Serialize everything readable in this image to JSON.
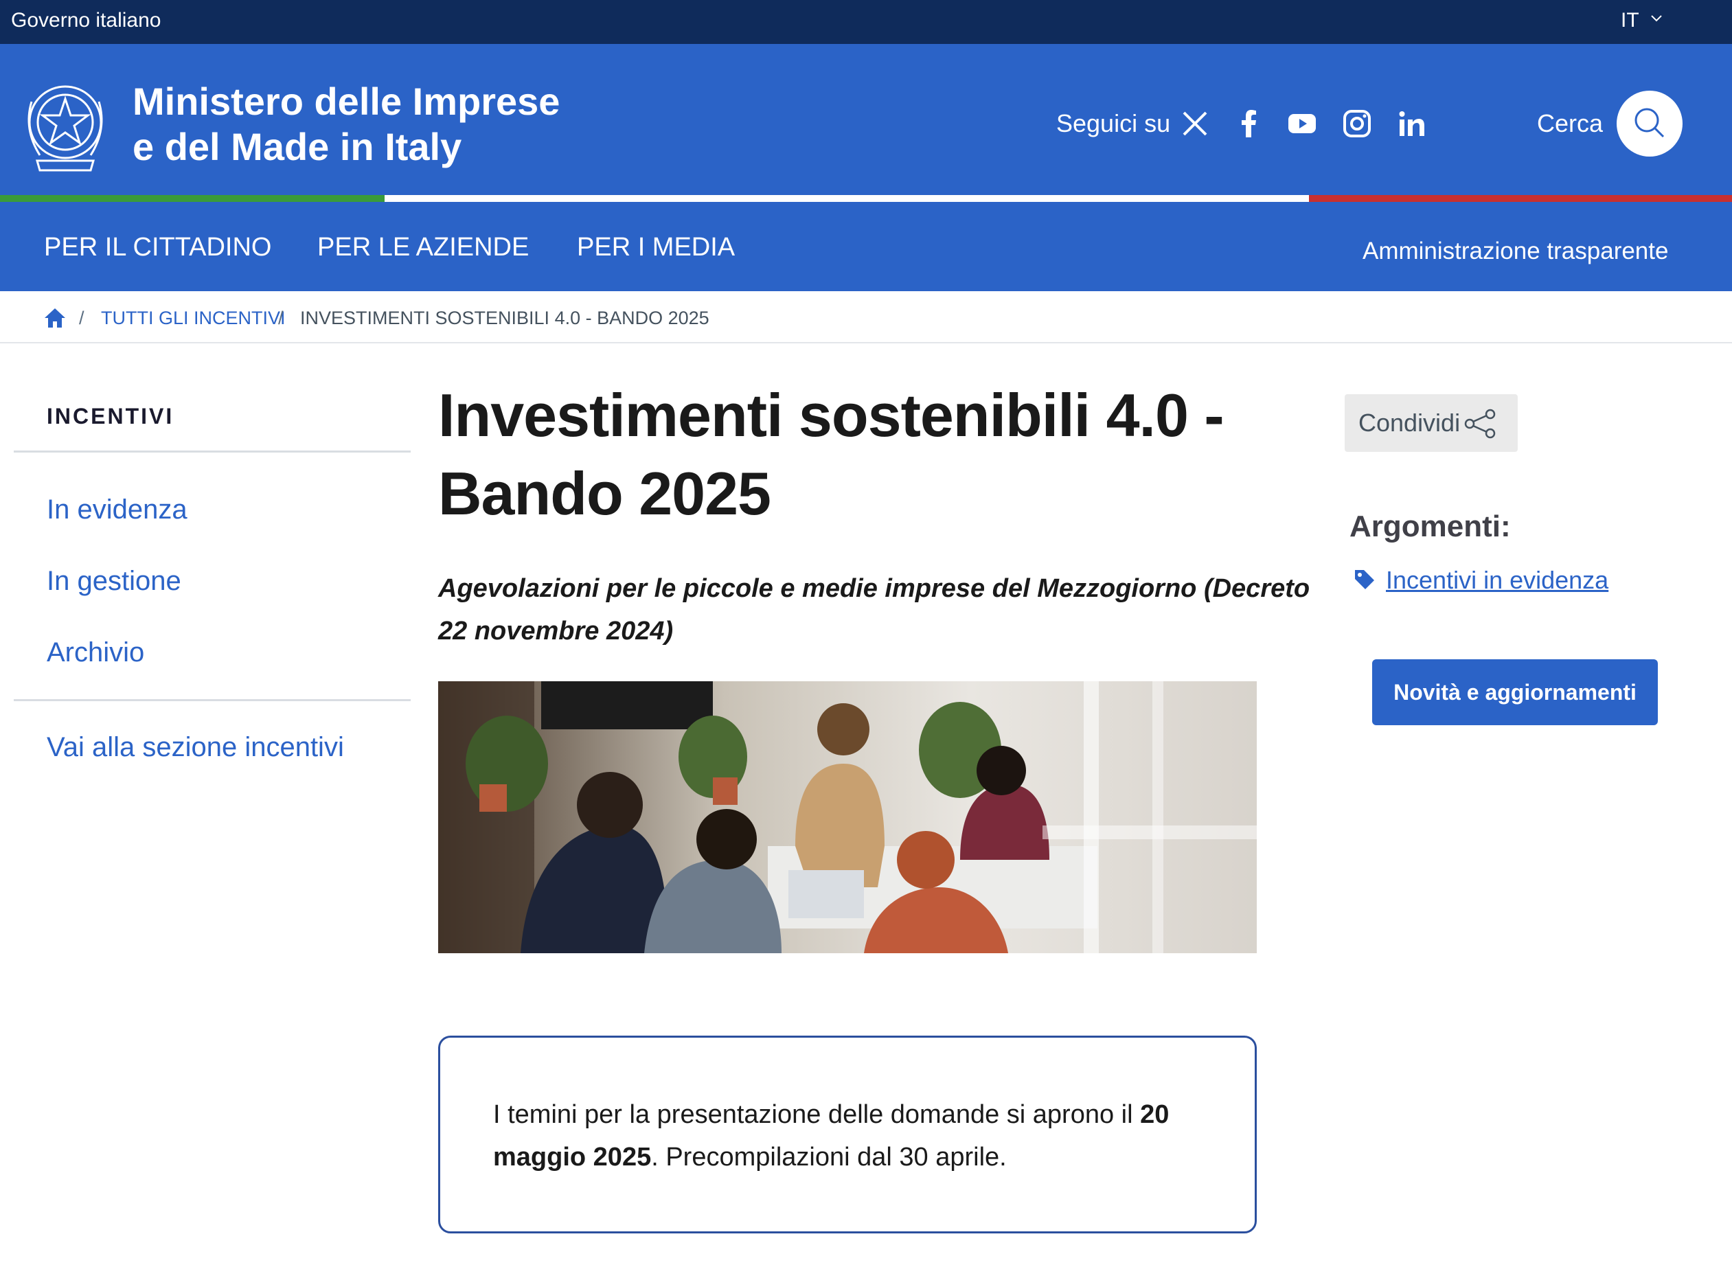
{
  "gov_bar": {
    "label": "Governo italiano",
    "language": "IT"
  },
  "header": {
    "title_line1": "Ministero delle Imprese",
    "title_line2": "e del Made in Italy",
    "follow_label": "Seguici su",
    "social_icons": [
      "x-icon",
      "facebook-icon",
      "youtube-icon",
      "instagram-icon",
      "linkedin-icon"
    ],
    "search_label": "Cerca"
  },
  "nav": {
    "items": [
      "PER IL CITTADINO",
      "PER LE AZIENDE",
      "PER I MEDIA"
    ],
    "admin_link": "Amministrazione trasparente"
  },
  "breadcrumb": {
    "items": [
      "TUTTI GLI INCENTIVI",
      "INVESTIMENTI SOSTENIBILI 4.0 - BANDO 2025"
    ],
    "separator": "/"
  },
  "sidebar": {
    "title": "INCENTIVI",
    "links": [
      "In evidenza",
      "In gestione",
      "Archivio"
    ],
    "section_link": "Vai alla sezione incentivi"
  },
  "main": {
    "title_line1": "Investimenti sostenibili 4.0 -",
    "title_line2": "Bando 2025",
    "subtitle_line1": "Agevolazioni per le piccole e medie imprese del Mezzogiorno (Decreto",
    "subtitle_line2": "22 novembre 2024)",
    "notice": {
      "line1_prefix": "I temini per la presentazione delle domande si aprono il ",
      "line1_bold": "20",
      "line2_bold": "maggio 2025",
      "line2_suffix": ". Precompilazioni dal 30 aprile."
    }
  },
  "aside": {
    "share_label": "Condividi",
    "topics_title": "Argomenti:",
    "topic_link": "Incentivi in evidenza",
    "news_button": "Novità e aggiornamenti"
  },
  "colors": {
    "gov_bar": "#0f2b5b",
    "brand_blue": "#2b63c7",
    "flag_green": "#3a9b3a",
    "flag_white": "#ffffff",
    "flag_red": "#c8302f"
  }
}
